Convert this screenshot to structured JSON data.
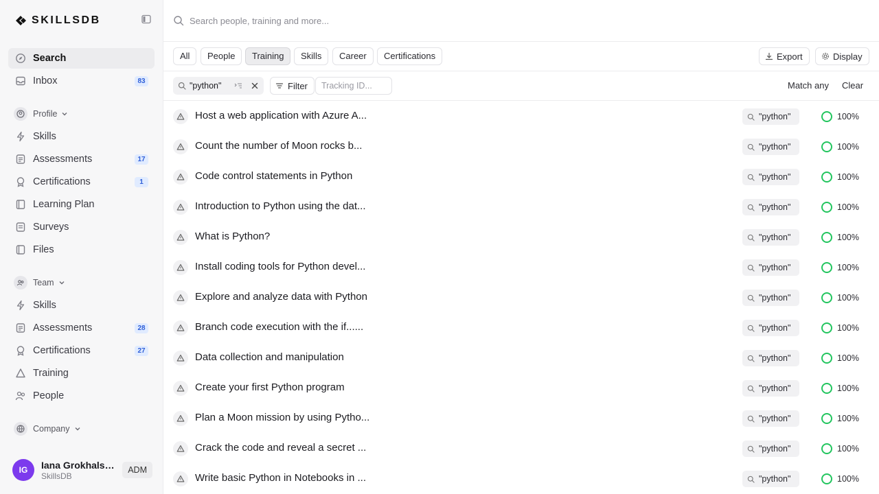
{
  "app": {
    "brand": "SKILLSDB"
  },
  "sidebar": {
    "top_items": [
      {
        "label": "Search",
        "icon": "compass-icon",
        "active": true
      },
      {
        "label": "Inbox",
        "icon": "inbox-icon",
        "badge": "83"
      }
    ],
    "profile": {
      "label": "Profile",
      "items": [
        {
          "label": "Skills",
          "icon": "bolt-icon"
        },
        {
          "label": "Assessments",
          "icon": "document-icon",
          "badge": "17"
        },
        {
          "label": "Certifications",
          "icon": "award-icon",
          "badge": "1"
        },
        {
          "label": "Learning Plan",
          "icon": "book-icon"
        },
        {
          "label": "Surveys",
          "icon": "survey-icon"
        },
        {
          "label": "Files",
          "icon": "files-icon"
        }
      ]
    },
    "team": {
      "label": "Team",
      "items": [
        {
          "label": "Skills",
          "icon": "bolt-icon"
        },
        {
          "label": "Assessments",
          "icon": "document-icon",
          "badge": "28"
        },
        {
          "label": "Certifications",
          "icon": "award-icon",
          "badge": "27"
        },
        {
          "label": "Training",
          "icon": "triangle-icon"
        },
        {
          "label": "People",
          "icon": "people-icon"
        }
      ]
    },
    "company": {
      "label": "Company"
    },
    "user": {
      "initials": "IG",
      "name": "Iana Grokhalskaia",
      "org": "SkillsDB",
      "role": "ADM"
    }
  },
  "search": {
    "placeholder": "Search people, training and more..."
  },
  "tabs": [
    {
      "label": "All"
    },
    {
      "label": "People"
    },
    {
      "label": "Training",
      "active": true
    },
    {
      "label": "Skills"
    },
    {
      "label": "Career"
    },
    {
      "label": "Certifications"
    }
  ],
  "toolbar": {
    "export_label": "Export",
    "display_label": "Display"
  },
  "filters": {
    "query": "\"python\"",
    "filter_label": "Filter",
    "tracking_placeholder": "Tracking ID...",
    "match_label": "Match any",
    "clear_label": "Clear"
  },
  "results": [
    {
      "title": "Host a web application with Azure A...",
      "match": "\"python\"",
      "score": "100%"
    },
    {
      "title": "Count the number of Moon rocks b...",
      "match": "\"python\"",
      "score": "100%"
    },
    {
      "title": "Code control statements in Python",
      "match": "\"python\"",
      "score": "100%"
    },
    {
      "title": "Introduction to Python using the dat...",
      "match": "\"python\"",
      "score": "100%"
    },
    {
      "title": "What is Python?",
      "match": "\"python\"",
      "score": "100%"
    },
    {
      "title": "Install coding tools for Python devel...",
      "match": "\"python\"",
      "score": "100%"
    },
    {
      "title": "Explore and analyze data with Python",
      "match": "\"python\"",
      "score": "100%"
    },
    {
      "title": "Branch code execution with the if......",
      "match": "\"python\"",
      "score": "100%"
    },
    {
      "title": "Data collection and manipulation",
      "match": "\"python\"",
      "score": "100%"
    },
    {
      "title": "Create your first Python program",
      "match": "\"python\"",
      "score": "100%"
    },
    {
      "title": "Plan a Moon mission by using Pytho...",
      "match": "\"python\"",
      "score": "100%"
    },
    {
      "title": "Crack the code and reveal a secret ...",
      "match": "\"python\"",
      "score": "100%"
    },
    {
      "title": "Write basic Python in Notebooks in ...",
      "match": "\"python\"",
      "score": "100%"
    }
  ],
  "colors": {
    "accent": "#2f5fd8",
    "score_ring": "#22c55e",
    "avatar": "#7c3aed",
    "badge_bg": "#e0ebff"
  }
}
